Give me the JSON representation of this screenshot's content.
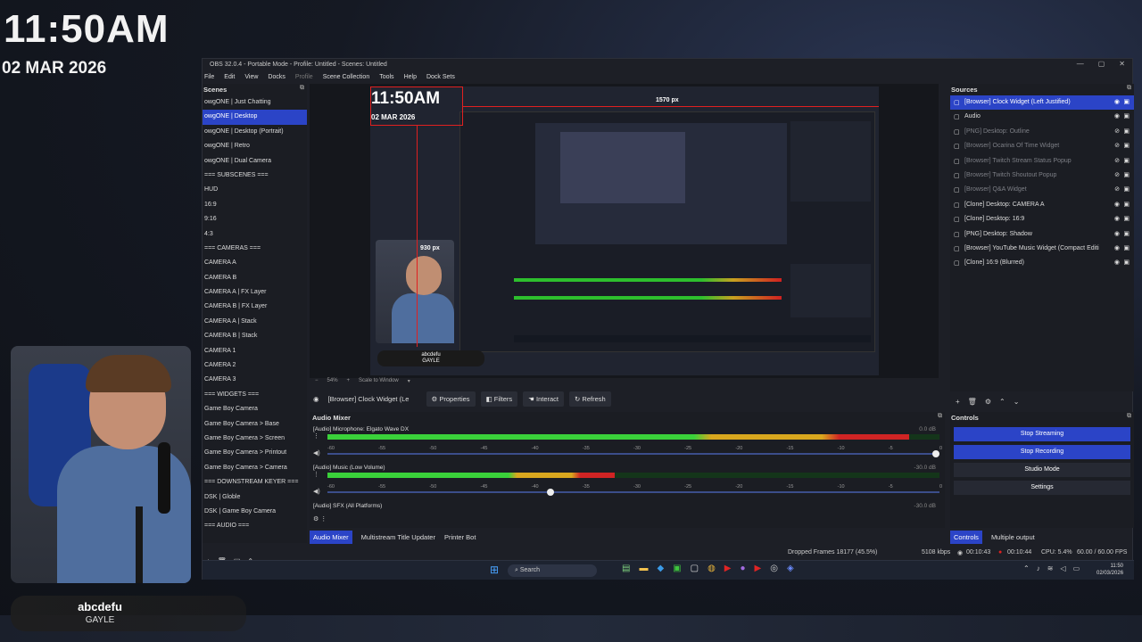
{
  "overlay": {
    "clock_time": "11:50AM",
    "clock_date": "02 MAR 2026",
    "song_title": "abcdefu",
    "song_artist": "GAYLE"
  },
  "window": {
    "title": "OBS 32.0.4 - Portable Mode - Profile: Untitled - Scenes: Untitled",
    "controls": [
      "—",
      "▢",
      "✕"
    ]
  },
  "menu": [
    "File",
    "Edit",
    "View",
    "Docks",
    "Profile",
    "Scene Collection",
    "Tools",
    "Help",
    "Dock Sets"
  ],
  "scenes": {
    "header": "Scenes",
    "items": [
      "owgONE | Just Chatting",
      "owgONE | Desktop",
      "owgONE | Desktop (Portrait)",
      "owgONE | Retro",
      "owgONE | Dual Camera",
      "=== SUBSCENES ===",
      "HUD",
      "16:9",
      "9:16",
      "4:3",
      "=== CAMERAS ===",
      "CAMERA A",
      "CAMERA B",
      "CAMERA A | FX Layer",
      "CAMERA B | FX Layer",
      "CAMERA A | Stack",
      "CAMERA B | Stack",
      "CAMERA 1",
      "CAMERA 2",
      "CAMERA 3",
      "=== WIDGETS ===",
      "Game Boy Camera",
      "Game Boy Camera > Base",
      "Game Boy Camera > Screen",
      "Game Boy Camera > Printout",
      "Game Boy Camera > Camera",
      "=== DOWNSTREAM KEYER ===",
      "DSK | Globle",
      "DSK | Game Boy Camera",
      "=== AUDIO ==="
    ],
    "selected_index": 1
  },
  "preview": {
    "clock_time": "11:50AM",
    "clock_date": "02 MAR 2026",
    "width_label": "1570 px",
    "height_label": "930 px",
    "song_title": "abcdefu",
    "song_artist": "GAYLE",
    "zoom": "54%",
    "scale_mode": "Scale to Window"
  },
  "source_toolbar": {
    "selected_source": "[Browser] Clock Widget (Le",
    "properties": "Properties",
    "filters": "Filters",
    "interact": "Interact",
    "refresh": "Refresh"
  },
  "mixer": {
    "header": "Audio Mixer",
    "channels": [
      {
        "name": "[Audio] Microphone: Elgato Wave DX",
        "db": "0.0 dB",
        "level": 0.95,
        "volume": 1.0
      },
      {
        "name": "[Audio] Music (Low Volume)",
        "db": "-30.0 dB",
        "level": 0.47,
        "volume": 0.37
      },
      {
        "name": "[Audio] SFX (All Platforms)",
        "db": "-30.0 dB",
        "level": 0,
        "volume": 0.37
      }
    ],
    "scale": [
      "-60",
      "-55",
      "-50",
      "-45",
      "-40",
      "-35",
      "-30",
      "-25",
      "-20",
      "-15",
      "-10",
      "-5",
      "0"
    ]
  },
  "bottom_tabs": [
    "Audio Mixer",
    "Multistream Title Updater",
    "Printer Bot"
  ],
  "sources": {
    "header": "Sources",
    "items": [
      {
        "label": "[Browser] Clock Widget (Left Justified)",
        "dim": false
      },
      {
        "label": "Audio",
        "dim": false
      },
      {
        "label": "[PNG] Desktop: Outline",
        "dim": true
      },
      {
        "label": "[Browser] Ocarina Of Time Widget",
        "dim": true
      },
      {
        "label": "[Browser] Twitch Stream Status Popup",
        "dim": true
      },
      {
        "label": "[Browser] Twitch Shoutout Popup",
        "dim": true
      },
      {
        "label": "[Browser] Q&A Widget",
        "dim": true
      },
      {
        "label": "[Clone] Desktop: CAMERA A",
        "dim": false
      },
      {
        "label": "[Clone] Desktop: 16:9",
        "dim": false
      },
      {
        "label": "[PNG] Desktop: Shadow",
        "dim": false
      },
      {
        "label": "[Browser] YouTube Music Widget (Compact Editi",
        "dim": false
      },
      {
        "label": "[Clone] 16:9 (Blurred)",
        "dim": false
      }
    ],
    "selected_index": 0
  },
  "controls": {
    "header": "Controls",
    "buttons": [
      "Stop Streaming",
      "Stop Recording",
      "Studio Mode",
      "Settings"
    ],
    "tabs": [
      "Controls",
      "Multiple output"
    ]
  },
  "status": {
    "dropped_frames": "Dropped Frames 18177 (45.5%)",
    "bitrate": "5108 kbps",
    "stream_time": "00:10:43",
    "rec_time": "00:10:44",
    "cpu": "CPU: 5.4%",
    "fps": "60.00 / 60.00 FPS"
  },
  "taskbar": {
    "search": "Search",
    "time": "11:50",
    "date": "02/03/2026"
  },
  "colors": {
    "accent": "#2b44c7",
    "meter_green": "#3ad13a",
    "meter_yellow": "#d9a71e",
    "meter_red": "#d02424"
  }
}
